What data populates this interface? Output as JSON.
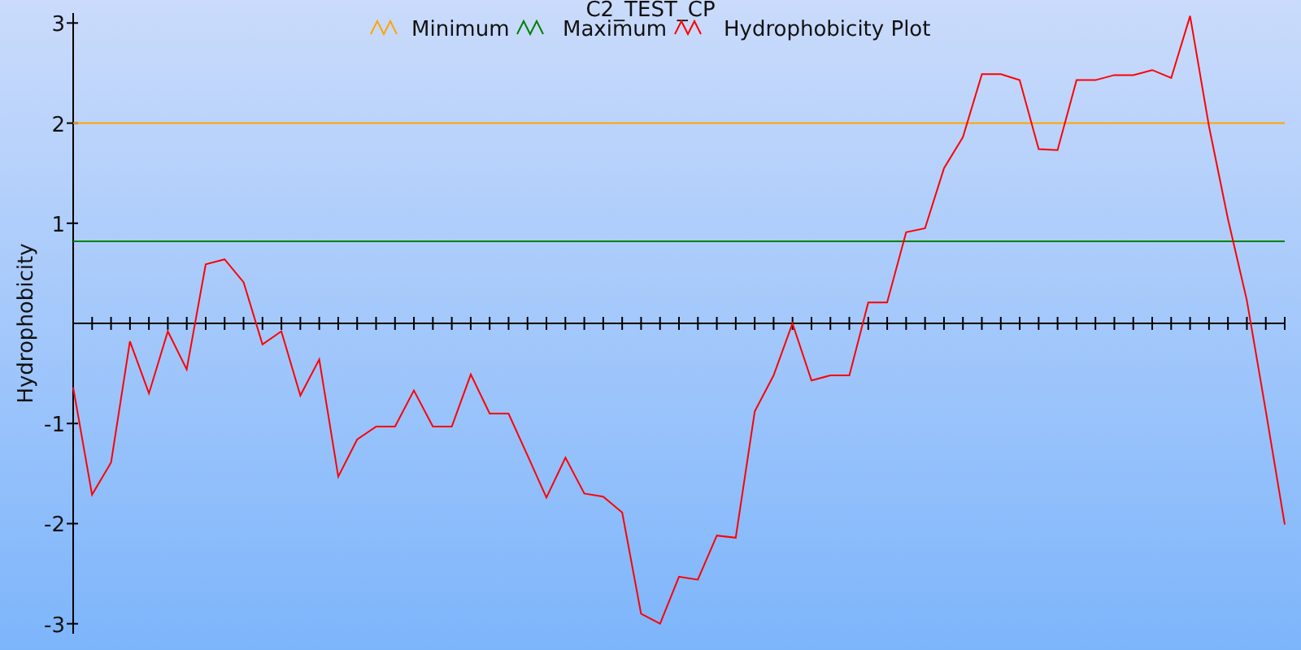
{
  "chart": {
    "chart_data": {
      "type": "line",
      "title": "C2_TEST_CP",
      "ylabel": "Hydrophobicity",
      "legend": true,
      "ylim": [
        -3.1,
        3.1
      ],
      "yticks": [
        -3,
        -2,
        -1,
        1,
        2,
        3
      ],
      "series": [
        {
          "name": "Minimum",
          "color": "#ffa500",
          "values": [
            2,
            2,
            2,
            2,
            2,
            2,
            2,
            2,
            2,
            2,
            2,
            2,
            2,
            2,
            2,
            2,
            2,
            2,
            2,
            2,
            2,
            2,
            2,
            2,
            2,
            2,
            2,
            2,
            2,
            2,
            2,
            2,
            2,
            2,
            2,
            2,
            2,
            2,
            2,
            2,
            2,
            2,
            2,
            2,
            2,
            2,
            2,
            2,
            2,
            2,
            2,
            2,
            2,
            2,
            2,
            2,
            2,
            2,
            2,
            2,
            2,
            2,
            2,
            2,
            2
          ]
        },
        {
          "name": "Maximum",
          "color": "#008000",
          "values": [
            0.82,
            0.82,
            0.82,
            0.82,
            0.82,
            0.82,
            0.82,
            0.82,
            0.82,
            0.82,
            0.82,
            0.82,
            0.82,
            0.82,
            0.82,
            0.82,
            0.82,
            0.82,
            0.82,
            0.82,
            0.82,
            0.82,
            0.82,
            0.82,
            0.82,
            0.82,
            0.82,
            0.82,
            0.82,
            0.82,
            0.82,
            0.82,
            0.82,
            0.82,
            0.82,
            0.82,
            0.82,
            0.82,
            0.82,
            0.82,
            0.82,
            0.82,
            0.82,
            0.82,
            0.82,
            0.82,
            0.82,
            0.82,
            0.82,
            0.82,
            0.82,
            0.82,
            0.82,
            0.82,
            0.82,
            0.82,
            0.82,
            0.82,
            0.82,
            0.82,
            0.82,
            0.82,
            0.82,
            0.82,
            0.82
          ]
        },
        {
          "name": "Hydrophobicity Plot",
          "color": "#ff0000",
          "values": [
            -0.64,
            -1.71,
            -1.39,
            -0.18,
            -0.7,
            -0.08,
            -0.46,
            0.59,
            0.64,
            0.41,
            -0.21,
            -0.08,
            -0.72,
            -0.36,
            -1.53,
            -1.16,
            -1.03,
            -1.03,
            -0.67,
            -1.03,
            -1.03,
            -0.51,
            -0.9,
            -0.9,
            -1.32,
            -1.74,
            -1.34,
            -1.7,
            -1.73,
            -1.89,
            -2.9,
            -3.0,
            -2.53,
            -2.56,
            -2.12,
            -2.14,
            -0.88,
            -0.52,
            0,
            -0.57,
            -0.52,
            -0.52,
            0.21,
            0.21,
            0.91,
            0.95,
            1.55,
            1.86,
            2.49,
            2.49,
            2.43,
            1.74,
            1.73,
            2.43,
            2.43,
            2.48,
            2.48,
            2.53,
            2.45,
            3.07,
            1.97,
            1.04,
            0.23,
            -0.88,
            -2.01
          ]
        }
      ]
    }
  }
}
